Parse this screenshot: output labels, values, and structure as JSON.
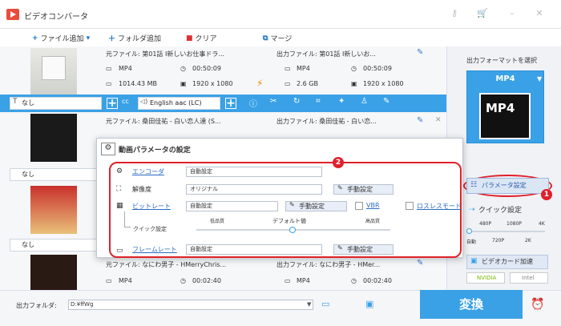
{
  "app": {
    "title": "ビデオコンバータ"
  },
  "toolbar": {
    "add_file": "ファイル追加",
    "add_folder": "フォルダ追加",
    "clear": "クリア",
    "merge": "マージ"
  },
  "rows": [
    {
      "src": "元ファイル: 第01話 I新しいお仕事ドラ...",
      "out": "出力ファイル: 第01話 I新しいお...",
      "fmt": "MP4",
      "dur": "00:50:09",
      "size": "1014.43 MB",
      "res": "1920 x 1080",
      "ofmt": "MP4",
      "odur": "00:50:09",
      "osize": "2.6 GB",
      "ores": "1920 x 1080"
    },
    {
      "src": "元ファイル: 桑田佳祐 - 白い恋人達 (S...",
      "out": "出力ファイル: 桑田佳祐 - 白い恋..."
    },
    {
      "src": "元ファイル: なにわ男子 - HMerryChris...",
      "out": "出力ファイル: なにわ男子 - HMer...",
      "fmt": "MP4",
      "dur": "00:02:40",
      "ofmt": "MP4",
      "odur": "00:02:40"
    }
  ],
  "optbar": {
    "subtitle": "なし",
    "audio": "English aac (LC)"
  },
  "row2sub": "なし",
  "row3sub": "なし",
  "right": {
    "format_label": "出力フォーマットを選択",
    "format": "MP4",
    "mp4": "MP4",
    "param_button": "パラメータ設定",
    "quick": "クイック設定",
    "ticks_top": [
      "480P",
      "1080P",
      "4K"
    ],
    "ticks_bottom": [
      "自動",
      "720P",
      "2K"
    ],
    "gpu": "ビデオカード加速",
    "nvidia": "NVIDIA",
    "intel": "Intel"
  },
  "dialog": {
    "title": "動画パラメータの設定",
    "encoder_label": "エンコーダ",
    "encoder": "自動設定",
    "resolution_label": "解像度",
    "resolution": "オリジナル",
    "manual": "手動設定",
    "bitrate_label": "ビットレート",
    "bitrate": "自動設定",
    "vbr": "VBR",
    "lossless": "ロスレスモード",
    "quick": "クイック設定",
    "low": "低品質",
    "default": "デフォルト値",
    "high": "高品質",
    "framerate_label": "フレームレート",
    "framerate": "自動設定"
  },
  "badges": {
    "one": "1",
    "two": "2"
  },
  "bottom": {
    "out_label": "出力フォルダ:",
    "out_path": "D:¥ffWg",
    "convert": "変換"
  },
  "colors": {
    "accent": "#3aa1e6",
    "highlight": "#e0202a"
  }
}
